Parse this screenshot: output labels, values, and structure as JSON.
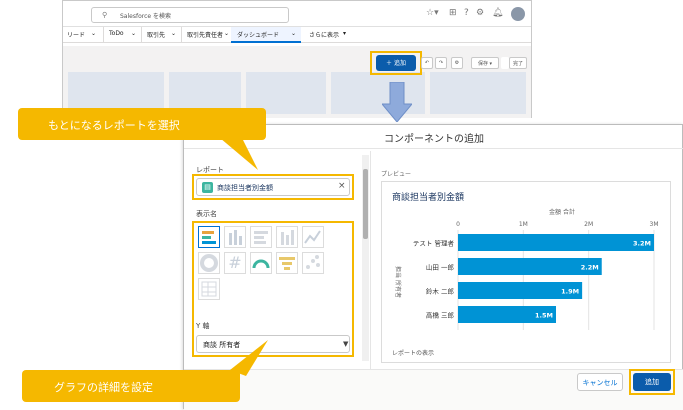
{
  "top": {
    "search_placeholder": "Salesforce を検索",
    "nav": [
      "リード",
      "ToDo",
      "取引先",
      "取引先責任者",
      "ダッシュボード",
      "さらに表示"
    ]
  },
  "toolbar": {
    "add_label": "＋ 追加",
    "save_label": "保存",
    "done_label": "完了"
  },
  "modal": {
    "title": "コンポーネントの追加",
    "report_label": "レポート",
    "report_value": "商談担当者別金額",
    "display_label": "表示名",
    "y_axis_label": "Y 軸",
    "y_axis_value": "商談 所有者",
    "preview_label": "プレビュー",
    "cancel_label": "キャンセル",
    "add_label": "追加"
  },
  "callouts": {
    "select_report": "もとになるレポートを選択",
    "set_details": "グラフの詳細を設定"
  },
  "chart_data": {
    "type": "bar",
    "orientation": "horizontal",
    "title": "商談担当者別金額",
    "xlabel": "金額 合計",
    "ylabel": "担当 所有者",
    "x_ticks": [
      "0",
      "1M",
      "2M",
      "3M"
    ],
    "xlim": [
      0,
      3
    ],
    "categories": [
      "テスト 管理者",
      "山田 一郎",
      "鈴木 二郎",
      "高橋 三郎"
    ],
    "values": [
      3.2,
      2.2,
      1.9,
      1.5
    ],
    "value_labels": [
      "3.2M",
      "2.2M",
      "1.9M",
      "1.5M"
    ],
    "bar_color": "#0093d5",
    "grid": true,
    "footer_link": "レポートの表示"
  },
  "colors": {
    "accent": "#0b5cab",
    "highlight": "#f5b800"
  }
}
